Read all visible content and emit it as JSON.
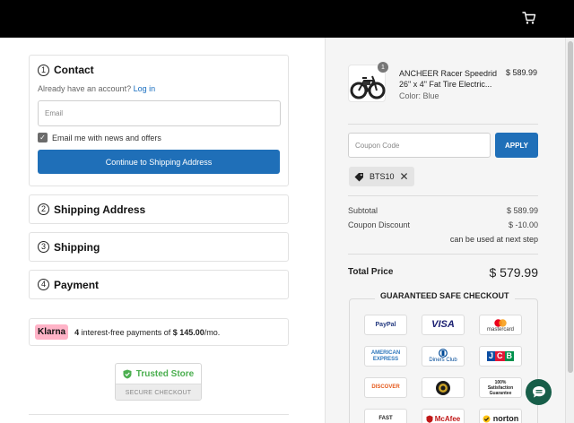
{
  "header": {
    "cart_icon": "cart-icon"
  },
  "contact": {
    "step": "1",
    "title": "Contact",
    "account_prompt": "Already have an account?",
    "login_label": "Log in",
    "email_placeholder": "Email",
    "email_value": "",
    "newsletter_label": "Email me with news and offers",
    "newsletter_checked": true,
    "continue_label": "Continue to Shipping Address"
  },
  "steps": [
    {
      "step": "2",
      "title": "Shipping Address"
    },
    {
      "step": "3",
      "title": "Shipping"
    },
    {
      "step": "4",
      "title": "Payment"
    }
  ],
  "klarna": {
    "badge": "Klarna",
    "count": "4",
    "text": "interest-free payments of",
    "amount": "$ 145.00",
    "suffix": "/mo."
  },
  "trust": {
    "title": "Trusted Store",
    "subtitle": "SECURE CHECKOUT"
  },
  "order": {
    "item": {
      "quantity": "1",
      "name": "ANCHEER Racer Speedrid 26\" x 4\" Fat Tire Electric...",
      "color": "Color: Blue",
      "price": "$ 589.99"
    },
    "coupon_placeholder": "Coupon Code",
    "apply_label": "APPLY",
    "applied_code": "BTS10",
    "subtotal_label": "Subtotal",
    "subtotal_value": "$ 589.99",
    "discount_label": "Coupon Discount",
    "discount_value": "$ -10.00",
    "discount_note": "can be used at next step",
    "total_label": "Total Price",
    "total_value": "$ 579.99"
  },
  "guarantee": {
    "title": "GUARANTEED SAFE CHECKOUT",
    "logos": [
      "PayPal",
      "VISA",
      "mastercard",
      "AMERICAN EXPRESS",
      "Diners Club",
      "JCB",
      "DISCOVER",
      "",
      "100% Satisfaction Guarantee",
      "FAST",
      "McAfee",
      "norton"
    ]
  },
  "colors": {
    "primary_button": "#1f6fb8",
    "link": "#1a6fc0",
    "trusted_green": "#4caf50",
    "klarna_pink": "#ffb3c7",
    "chat_button": "#175e49",
    "topbar": "#000000"
  }
}
